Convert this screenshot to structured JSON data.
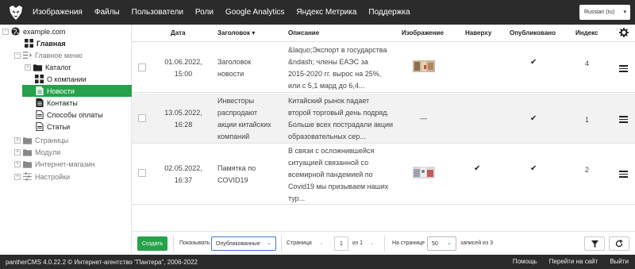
{
  "nav": {
    "items": [
      "Изображения",
      "Файлы",
      "Пользователи",
      "Роли",
      "Google Analytics",
      "Яндекс Метрика",
      "Поддержка"
    ],
    "language": "Russian (ru)"
  },
  "tree": {
    "site": "example.com",
    "home": "Главная",
    "main_menu": "Главное меню",
    "catalog": "Каталог",
    "about": "О компании",
    "news": "Новости",
    "contacts": "Контакты",
    "payment": "Способы оплаты",
    "articles": "Статьи",
    "pages": "Страницы",
    "modules": "Модули",
    "shop": "Интернет-магазин",
    "settings": "Настройки"
  },
  "table": {
    "headers": {
      "date": "Дата",
      "title": "Заголовок",
      "description": "Описание",
      "image": "Изображение",
      "top": "Наверху",
      "published": "Опубликовано",
      "index": "Индекс"
    },
    "rows": [
      {
        "date": "01.06.2022,",
        "time": "15:00",
        "title": [
          "Заголовок",
          "новости"
        ],
        "desc": [
          "&laquo;Экспорт в государства",
          "&ndash; члены ЕАЭС за",
          "2015-2020 гг. вырос на 25%,",
          "или с 5,1 мард до 6,4..."
        ],
        "top": "",
        "published": "✔",
        "index": "4"
      },
      {
        "date": "13.05.2022,",
        "time": "16:28",
        "title": [
          "Инвесторы",
          "распродают",
          "акции китайских",
          "компаний"
        ],
        "desc": [
          "Китайский рынок падает",
          "второй торговый день подряд.",
          "Больше всех пострадали акции",
          "образовательных сер..."
        ],
        "image_placeholder": "—",
        "top": "",
        "published": "✔",
        "index": "1"
      },
      {
        "date": "02.05.2022,",
        "time": "16:37",
        "title": [
          "Памятка по",
          "COVID19"
        ],
        "desc": [
          "В связи с осложнившейся",
          "ситуацией связанной со",
          "всемирной пандемией по",
          "Covid19 мы призываем наших",
          "тур..."
        ],
        "top": "✔",
        "published": "✔",
        "index": "2"
      }
    ]
  },
  "pager": {
    "create": "Создать",
    "show_label": "Показывать",
    "show_value": "Опубликованные",
    "page_label": "Страница",
    "page_value": "1",
    "of_pages": "из 1",
    "per_page_label": "На странице",
    "per_page_value": "50",
    "records": "записей из 3",
    "prev": "‹",
    "next": "›"
  },
  "footer": {
    "copyright": "pantherCMS 4.0.22.2 © Интернет-агентство \"Пантера\", 2006-2022",
    "help": "Помощь",
    "go_site": "Перейти на сайт",
    "logout": "Выйти"
  },
  "colors": {
    "accent": "#27a14a",
    "dark": "#2b2b2b"
  }
}
